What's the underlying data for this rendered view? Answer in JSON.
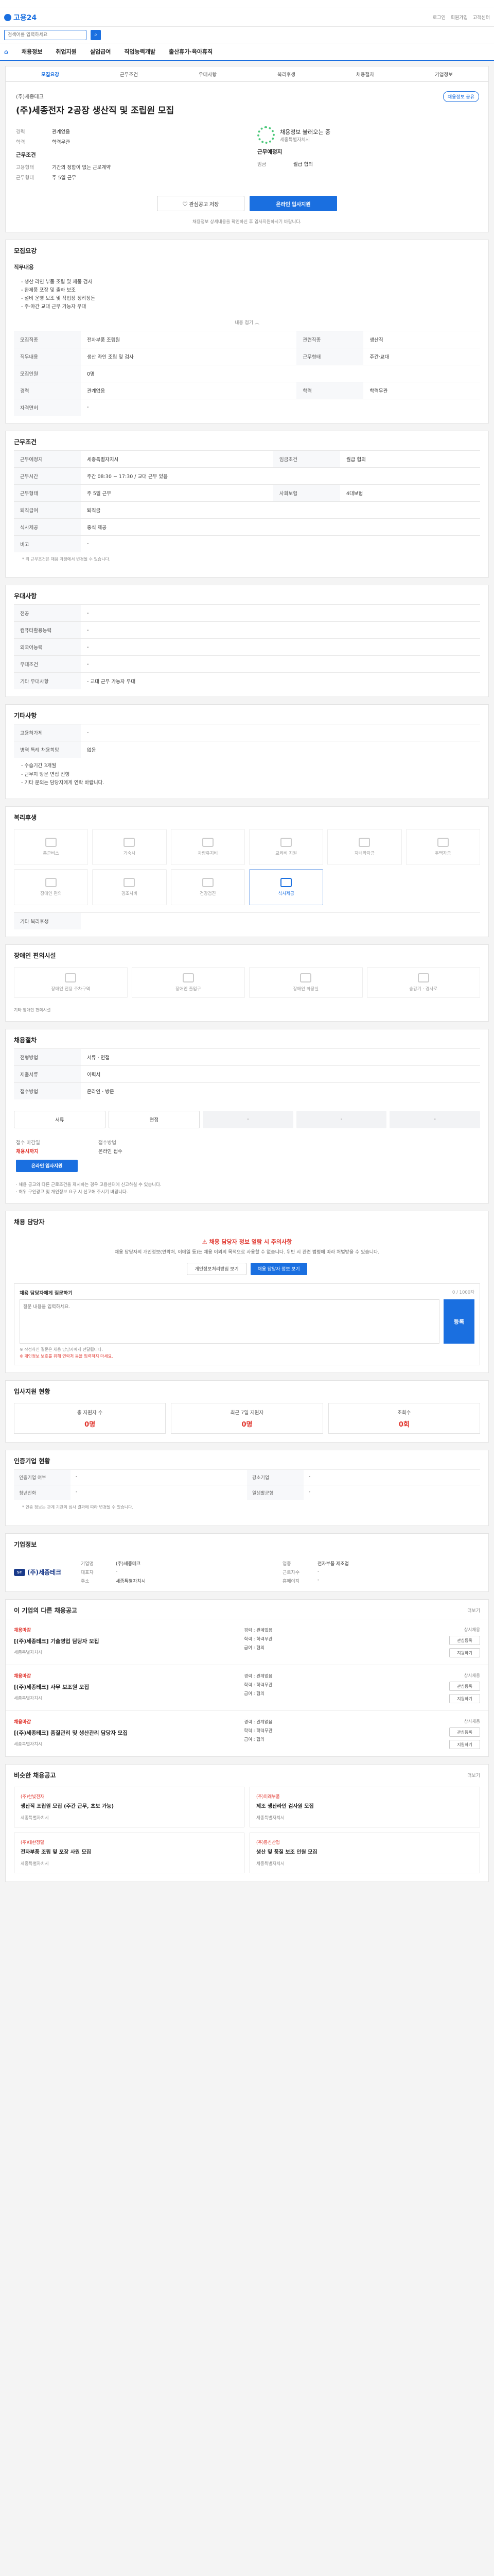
{
  "topbar": {
    "notice": ""
  },
  "gnb": {
    "logo": "고용24",
    "links": [
      "로그인",
      "회원가입",
      "고객센터"
    ]
  },
  "search": {
    "placeholder": "검색어를 입력하세요"
  },
  "mainnav": {
    "items": [
      "채용정보",
      "취업지원",
      "실업급여",
      "직업능력개발",
      "출산휴가·육아휴직"
    ]
  },
  "detail_tabs": [
    "모집요강",
    "근무조건",
    "우대사항",
    "복리후생",
    "채용절차",
    "기업정보"
  ],
  "job": {
    "company": "(주)세종테크",
    "title": "(주)세종전자 2공장 생산직 및 조립원 모집",
    "share": "채용정보 공유",
    "left": [
      {
        "k": "경력",
        "v": "관계없음"
      },
      {
        "k": "학력",
        "v": "학력무관"
      }
    ],
    "right_loading": "채용정보 불러오는 중",
    "right_sub": "세종특별자치시",
    "basic_title": "근무조건",
    "basic": [
      {
        "k": "고용형태",
        "v": "기간의 정함이 없는 근로계약"
      },
      {
        "k": "근무형태",
        "v": "주 5일 근무"
      }
    ],
    "basic_right_title": "근무예정지",
    "basic_right": [
      {
        "k": "임금",
        "v": "월급 협의"
      }
    ],
    "btn_save": "관심공고 저장",
    "btn_apply": "온라인 입사지원",
    "hint": "채용정보 상세내용을 확인하신 후 입사지원하시기 바랍니다."
  },
  "recruit": {
    "title": "모집요강",
    "duty_title": "직무내용",
    "duty": "- 생산 라인 부품 조립 및 제품 검사\n- 완제품 포장 및 출하 보조\n- 설비 운영 보조 및 작업장 정리정돈\n- 주·야간 교대 근무 가능자 우대",
    "fold": "내용 접기",
    "rows": [
      {
        "k": "모집직종",
        "v": "전자부품 조립원",
        "k2": "관련직종",
        "v2": "생산직"
      },
      {
        "k": "직무내용",
        "v": "생산 라인 조립 및 검사",
        "k2": "근무형태",
        "v2": "주간·교대"
      },
      {
        "k": "모집인원",
        "v": "0명"
      },
      {
        "k": "경력",
        "v": "관계없음",
        "k2": "학력",
        "v2": "학력무관"
      },
      {
        "k": "자격면허",
        "v": "-"
      }
    ]
  },
  "conditions": {
    "title": "근무조건",
    "rows": [
      {
        "k": "근무예정지",
        "v": "세종특별자치시",
        "k2": "임금조건",
        "v2": "월급 협의"
      },
      {
        "k": "근무시간",
        "v": "주간 08:30 ~ 17:30 / 교대 근무 있음"
      },
      {
        "k": "근무형태",
        "v": "주 5일 근무",
        "k2": "사회보험",
        "v2": "4대보험"
      },
      {
        "k": "퇴직급여",
        "v": "퇴직금"
      },
      {
        "k": "식사제공",
        "v": "중식 제공"
      },
      {
        "k": "비고",
        "v": "-"
      }
    ],
    "note": "* 위 근무조건은 채용 과정에서 변경될 수 있습니다."
  },
  "preference": {
    "title": "우대사항",
    "rows": [
      {
        "k": "전공",
        "v": "-"
      },
      {
        "k": "컴퓨터활용능력",
        "v": "-"
      },
      {
        "k": "외국어능력",
        "v": "-"
      },
      {
        "k": "우대조건",
        "v": "-"
      },
      {
        "k": "기타 우대사항",
        "v": "- 교대 근무 가능자 우대"
      }
    ]
  },
  "etc": {
    "title": "기타사항",
    "rows": [
      {
        "k": "고용허가제",
        "v": "-"
      },
      {
        "k": "병역 특례 채용희망",
        "v": "없음"
      }
    ],
    "text": "- 수습기간 3개월\n- 근무지 방문 면접 진행\n- 기타 문의는 담당자에게 연락 바랍니다."
  },
  "welfare": {
    "title": "복리후생",
    "items": [
      {
        "label": "통근버스",
        "on": false
      },
      {
        "label": "기숙사",
        "on": false
      },
      {
        "label": "차량유지비",
        "on": false
      },
      {
        "label": "교육비 지원",
        "on": false
      },
      {
        "label": "자녀학자금",
        "on": false
      },
      {
        "label": "주택자금",
        "on": false
      },
      {
        "label": "장애인 편의",
        "on": false
      },
      {
        "label": "경조사비",
        "on": false
      },
      {
        "label": "건강검진",
        "on": false
      },
      {
        "label": "식사제공",
        "on": true
      }
    ],
    "extra_label": "기타 복리후생"
  },
  "facility": {
    "title": "장애인 편의시설",
    "items": [
      "장애인 전용 주차구역",
      "장애인 출입구",
      "장애인 화장실",
      "승강기 · 경사로"
    ],
    "note": "기타 장애인 편의시설"
  },
  "process": {
    "title": "채용절차",
    "rows": [
      {
        "k": "전형방법",
        "v": "서류 · 면접"
      },
      {
        "k": "제출서류",
        "v": "이력서"
      },
      {
        "k": "접수방법",
        "v": "온라인 · 방문"
      }
    ],
    "steps": [
      "서류",
      "면접",
      "-",
      "-",
      "-"
    ],
    "deadline_label": "접수 마감일",
    "deadline": "채용시까지",
    "method_label": "접수방법",
    "method": "온라인 접수",
    "apply_btn": "온라인 입사지원",
    "notes": "· 채용 공고와 다른 근로조건을 제시하는 경우 고용센터에 신고하실 수 있습니다.\n· 허위 구인광고 및 개인정보 요구 시 신고해 주시기 바랍니다."
  },
  "qna": {
    "title": "채용 담당자",
    "alert_title": "채용 담당자 정보 열람 시 주의사항",
    "alert_text": "채용 담당자의 개인정보(연락처, 이메일 등)는 채용 이외의 목적으로 사용할 수 없습니다. 위반 시 관련 법령에 따라 처벌받을 수 있습니다.",
    "btn_guide": "개인정보처리방침 보기",
    "btn_view": "채용 담당자 정보 보기",
    "form_label": "채용 담당자에게 질문하기",
    "count": "0 / 1000자",
    "placeholder": "질문 내용을 입력하세요.",
    "submit": "등록",
    "foot1": "※ 작성하신 질문은 채용 담당자에게 전달됩니다.",
    "foot2": "※ 개인정보 보호를 위해 연락처 등을 입력하지 마세요."
  },
  "apply_status": {
    "title": "입사지원 현황",
    "items": [
      {
        "label": "총 지원자 수",
        "value": "0명"
      },
      {
        "label": "최근 7일 지원자",
        "value": "0명"
      },
      {
        "label": "조회수",
        "value": "0회"
      }
    ]
  },
  "info": {
    "title": "인증기업 현황",
    "rows": [
      [
        "인증기업 여부",
        "-",
        "강소기업",
        "-"
      ],
      [
        "청년친화",
        "-",
        "일생활균형",
        "-"
      ]
    ],
    "note": "* 인증 정보는 관계 기관의 심사 결과에 따라 변경될 수 있습니다."
  },
  "company": {
    "title": "기업정보",
    "logo": "(주)세종테크",
    "logo_mark": "ST",
    "fields": [
      {
        "k": "기업명",
        "v": "(주)세종테크"
      },
      {
        "k": "업종",
        "v": "전자부품 제조업"
      },
      {
        "k": "대표자",
        "v": "-"
      },
      {
        "k": "근로자수",
        "v": "-"
      },
      {
        "k": "주소",
        "v": "세종특별자치시"
      },
      {
        "k": "홈페이지",
        "v": "-"
      }
    ]
  },
  "other_jobs": {
    "title": "이 기업의 다른 채용공고",
    "more": "더보기",
    "items": [
      {
        "co": "채용마감",
        "title": "[(주)세종테크] 기술영업 담당자 모집",
        "meta": "세종특별자치시",
        "mid": [
          "경력 : 관계없음",
          "학력 : 학력무관",
          "급여 : 협의"
        ],
        "date": "상시채용",
        "b1": "관심등록",
        "b2": "지원하기"
      },
      {
        "co": "채용마감",
        "title": "[(주)세종테크] 사무 보조원 모집",
        "meta": "세종특별자치시",
        "mid": [
          "경력 : 관계없음",
          "학력 : 학력무관",
          "급여 : 협의"
        ],
        "date": "상시채용",
        "b1": "관심등록",
        "b2": "지원하기"
      },
      {
        "co": "채용마감",
        "title": "[(주)세종테크] 품질관리 및 생산관리 담당자 모집",
        "meta": "세종특별자치시",
        "mid": [
          "경력 : 관계없음",
          "학력 : 학력무관",
          "급여 : 협의"
        ],
        "date": "상시채용",
        "b1": "관심등록",
        "b2": "지원하기"
      }
    ]
  },
  "recommend": {
    "title": "비슷한 채용공고",
    "more": "더보기",
    "items": [
      {
        "co": "(주)한빛전자",
        "title": "생산직 조립원 모집 (주간 근무, 초보 가능)",
        "meta": "세종특별자치시"
      },
      {
        "co": "(주)미래부품",
        "title": "제조 생산라인 검사원 모집",
        "meta": "세종특별자치시"
      },
      {
        "co": "(주)대한정밀",
        "title": "전자부품 조립 및 포장 사원 모집",
        "meta": "세종특별자치시"
      },
      {
        "co": "(주)동신산업",
        "title": "생산 및 품질 보조 인원 모집",
        "meta": "세종특별자치시"
      }
    ]
  },
  "colors": {
    "accent": "#1a6fe0",
    "alert": "#e0332b",
    "loader": "#4bc87a"
  }
}
